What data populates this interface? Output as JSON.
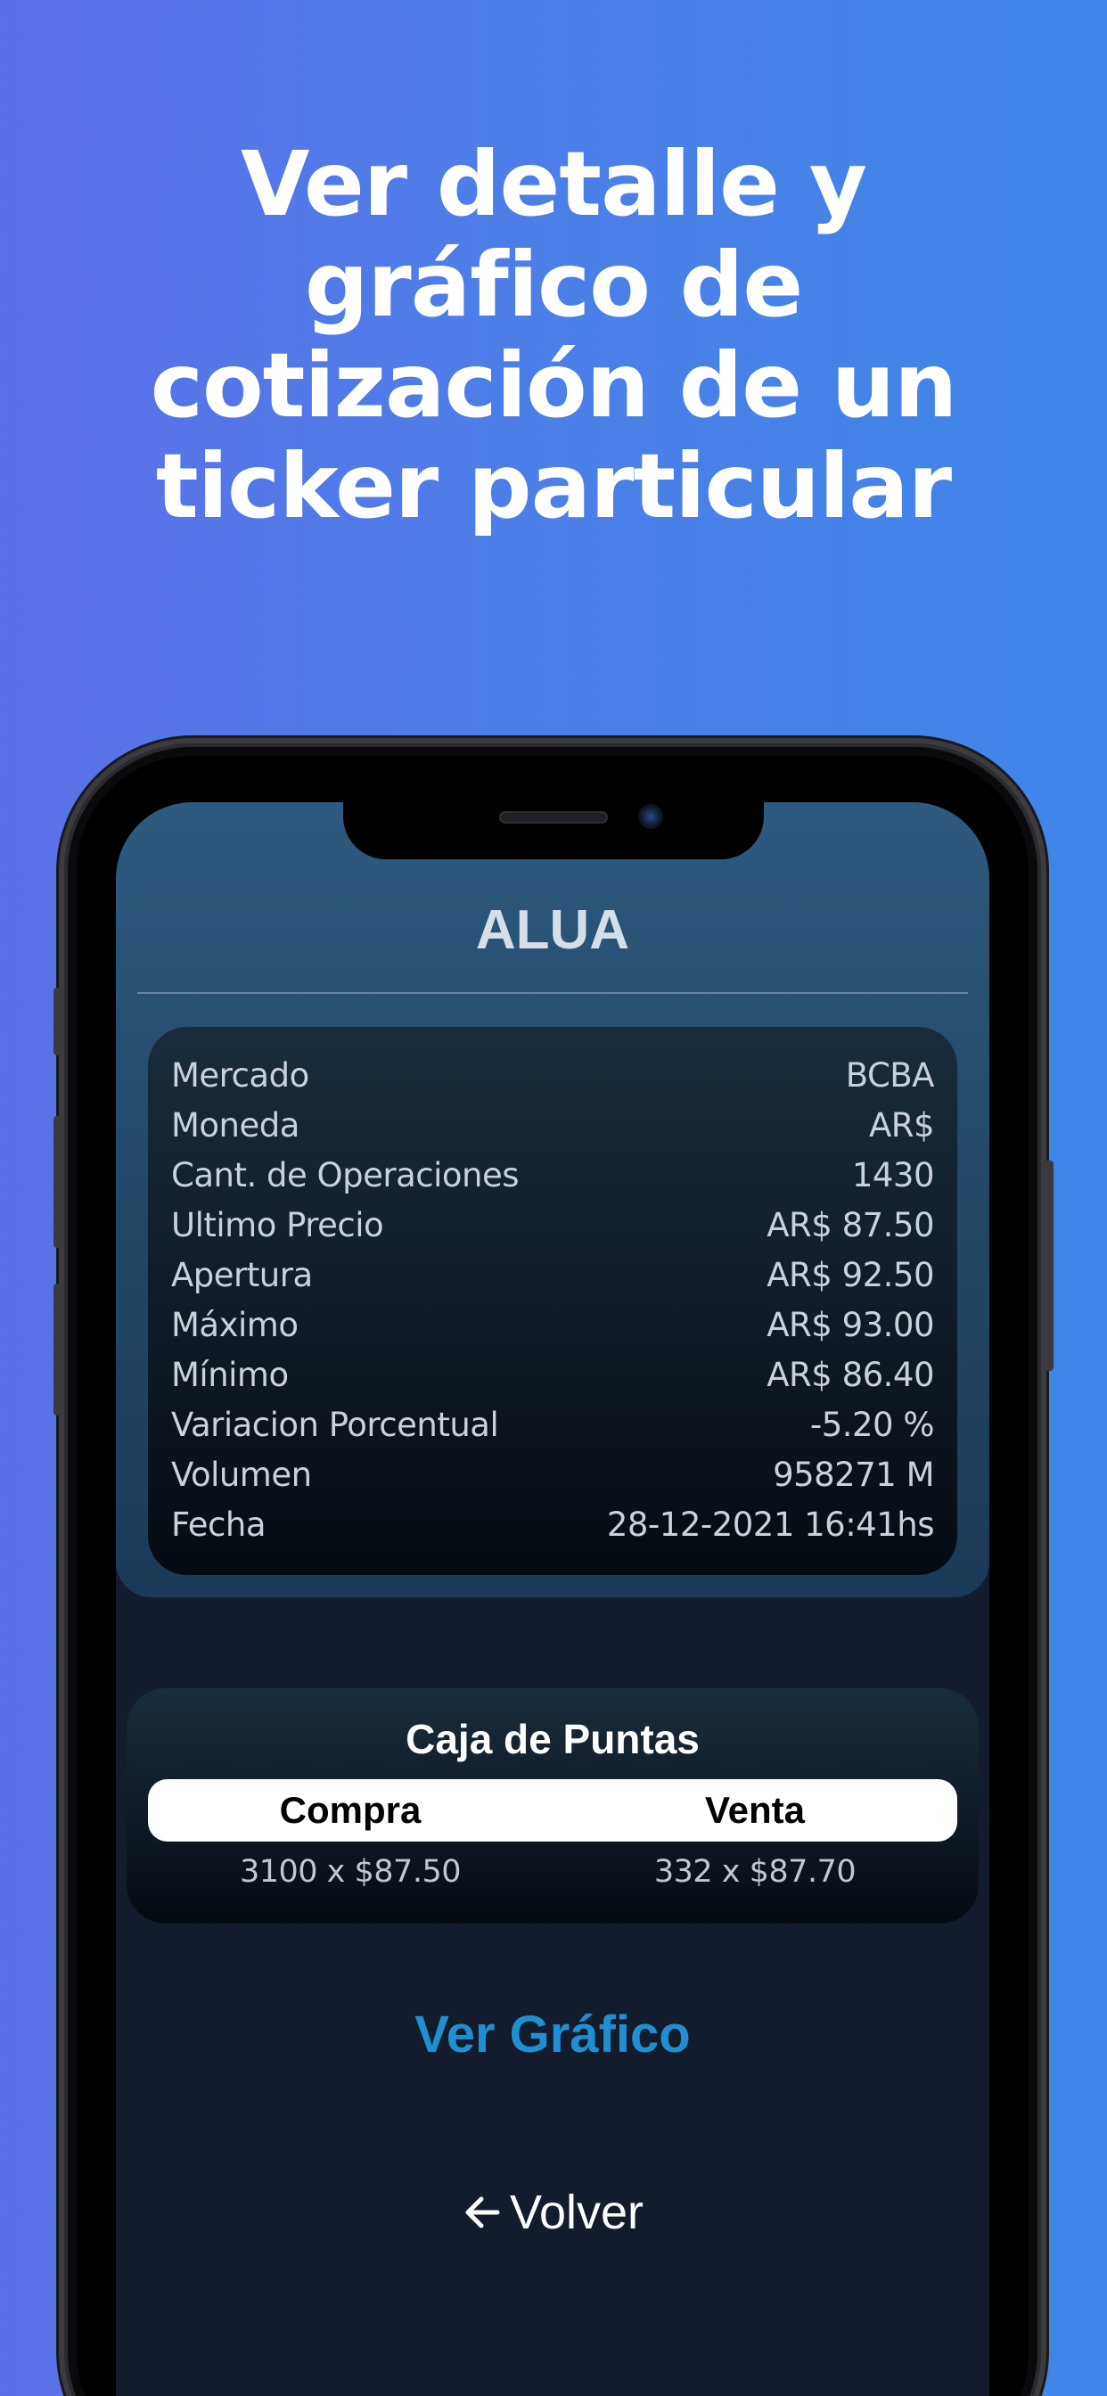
{
  "headline": {
    "lines": [
      "Ver detalle y",
      "gráfico de",
      "cotización  de un",
      "ticker particular"
    ]
  },
  "screen": {
    "ticker": "ALUA",
    "details": [
      {
        "label": "Mercado",
        "value": "BCBA"
      },
      {
        "label": "Moneda",
        "value": "AR$"
      },
      {
        "label": "Cant. de Operaciones",
        "value": "1430"
      },
      {
        "label": "Ultimo Precio",
        "value": "AR$ 87.50"
      },
      {
        "label": "Apertura",
        "value": "AR$ 92.50"
      },
      {
        "label": "Máximo",
        "value": "AR$ 93.00"
      },
      {
        "label": "Mínimo",
        "value": "AR$ 86.40"
      },
      {
        "label": "Variacion Porcentual",
        "value": "-5.20 %"
      },
      {
        "label": "Volumen",
        "value": "958271 M"
      },
      {
        "label": "Fecha",
        "value": "28-12-2021 16:41hs"
      }
    ],
    "puntas": {
      "title": "Caja de Puntas",
      "headers": [
        "Compra",
        "Venta"
      ],
      "values": [
        "3100 x $87.50",
        "332 x $87.70"
      ]
    },
    "ver_grafico_label": "Ver Gráfico",
    "volver_label": "Volver",
    "volver_icon": "arrow-left-icon"
  },
  "colors": {
    "background_start": "#5b70e8",
    "background_end": "#3f86e8",
    "link_blue": "#1f8fd1",
    "screen_bg": "#131c2d",
    "top_panel": "#2d5a7e"
  }
}
